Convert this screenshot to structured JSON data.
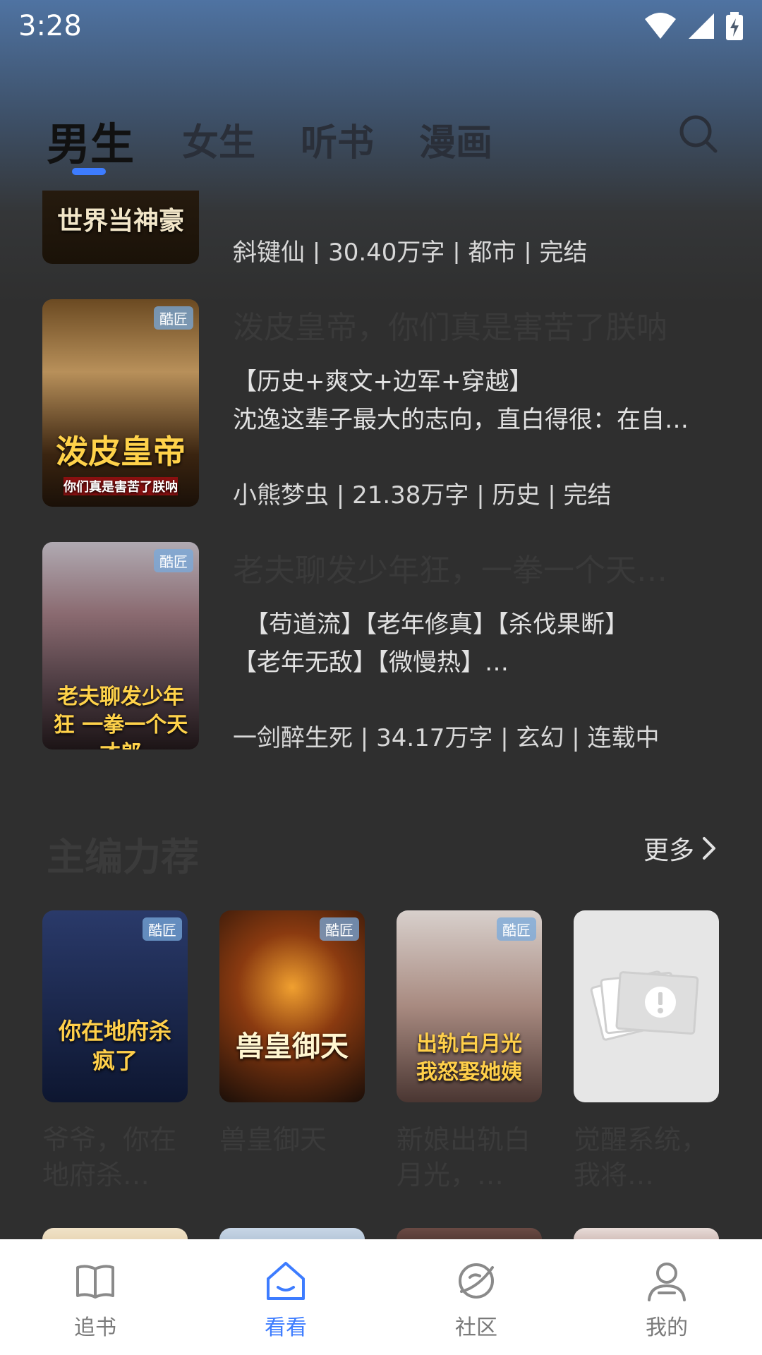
{
  "status": {
    "time": "3:28"
  },
  "tabs": [
    {
      "label": "男生",
      "active": true
    },
    {
      "label": "女生",
      "active": false
    },
    {
      "label": "听书",
      "active": false
    },
    {
      "label": "漫画",
      "active": false
    }
  ],
  "books": [
    {
      "cover_text": "世界当神豪",
      "title": "",
      "desc": [],
      "meta": "斜键仙 | 30.40万字 | 都市 | 完结"
    },
    {
      "cover_text": "泼皮皇帝",
      "cover_sub": "你们真是害苦了朕呐",
      "badge": "酷匠",
      "title": "泼皮皇帝，你们真是害苦了朕呐",
      "desc": [
        "【历史+爽文+边军+穿越】",
        "沈逸这辈子最大的志向，直白得很：在自…"
      ],
      "meta": "小熊梦虫 | 21.38万字 | 历史 | 完结"
    },
    {
      "cover_text": "老夫聊发少年狂 一拳一个天才郎",
      "badge": "酷匠",
      "title": "老夫聊发少年狂，一拳一个天…",
      "desc": [
        "　【苟道流】【老年修真】【杀伐果断】",
        "【老年无敌】【微慢热】…"
      ],
      "meta": "一剑醉生死 | 34.17万字 | 玄幻 | 连载中"
    }
  ],
  "section": {
    "title": "主编力荐",
    "more": "更多"
  },
  "grid": [
    {
      "cover_text": "你在地府杀疯了",
      "title": "爷爷，你在地府杀…",
      "badge": "酷匠",
      "colors": [
        "#2a3a6a",
        "#0d1630"
      ]
    },
    {
      "cover_text": "兽皇御天",
      "title": "兽皇御天",
      "badge": "酷匠",
      "colors": [
        "#8a3a10",
        "#1a0e08"
      ]
    },
    {
      "cover_text": "出轨白月光 我怒娶她姨",
      "title": "新娘出轨白月光，…",
      "badge": "酷匠",
      "colors": [
        "#c8c2c0",
        "#6e5a58"
      ]
    },
    {
      "cover_text": "",
      "title": "觉醒系统，我将…",
      "badge": "",
      "colors": [
        "#e6e6e6",
        "#e6e6e6"
      ]
    }
  ],
  "nav": [
    {
      "label": "追书",
      "icon": "book-icon",
      "active": false
    },
    {
      "label": "看看",
      "icon": "home-icon",
      "active": true
    },
    {
      "label": "社区",
      "icon": "community-icon",
      "active": false
    },
    {
      "label": "我的",
      "icon": "profile-icon",
      "active": false
    }
  ],
  "colors": {
    "accent": "#3d7cff",
    "background": "#2f2f2f"
  }
}
